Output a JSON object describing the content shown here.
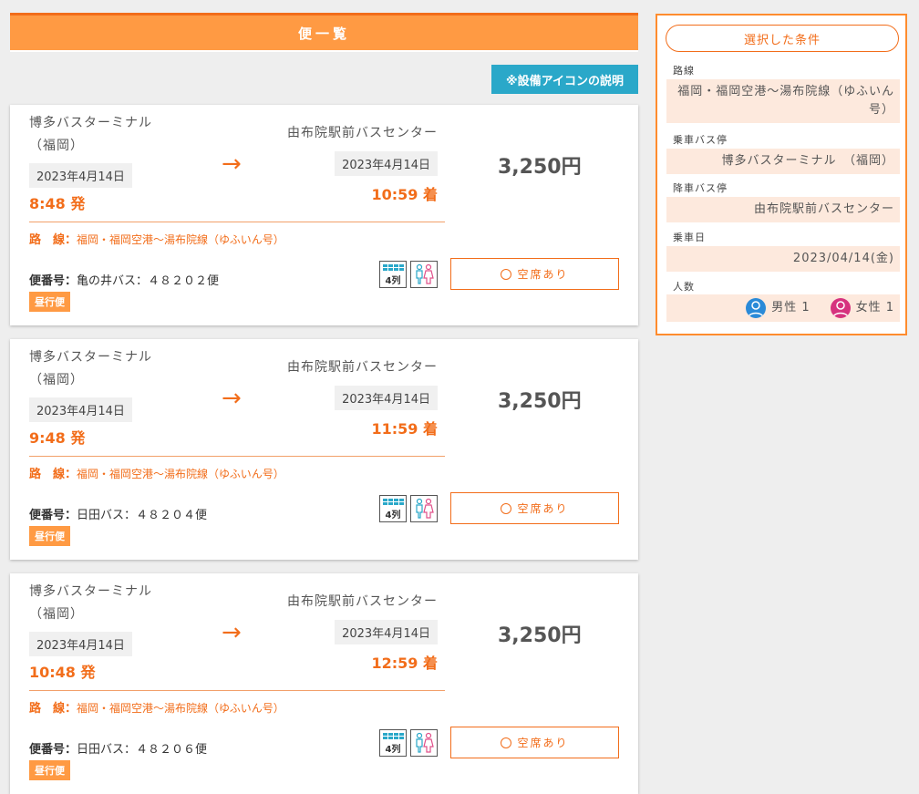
{
  "header": {
    "title": "便一覧"
  },
  "legend_button": "※設備アイコンの説明",
  "colors": {
    "accent": "#f26d1a",
    "header_bg": "#ff9a43",
    "info_button": "#2aa8c9"
  },
  "trips": [
    {
      "dep_name_line1": "博多バスターミナル",
      "dep_name_line2": "（福岡）",
      "dep_date": "2023年4月14日",
      "dep_time": "8:48 発",
      "arr_name": "由布院駅前バスセンター",
      "arr_date": "2023年4月14日",
      "arr_time": "10:59 着",
      "price": "3,250円",
      "route_label": "路　線：",
      "route_value": "福岡・福岡空港～湯布院線（ゆふいん号）",
      "flight_label": "便番号：",
      "flight_value": "亀の井バス：４８２０２便",
      "badge": "昼行便",
      "availability": "空席あり",
      "seat_icon_label": "4列"
    },
    {
      "dep_name_line1": "博多バスターミナル",
      "dep_name_line2": "（福岡）",
      "dep_date": "2023年4月14日",
      "dep_time": "9:48 発",
      "arr_name": "由布院駅前バスセンター",
      "arr_date": "2023年4月14日",
      "arr_time": "11:59 着",
      "price": "3,250円",
      "route_label": "路　線：",
      "route_value": "福岡・福岡空港～湯布院線（ゆふいん号）",
      "flight_label": "便番号：",
      "flight_value": "日田バス：４８２０４便",
      "badge": "昼行便",
      "availability": "空席あり",
      "seat_icon_label": "4列"
    },
    {
      "dep_name_line1": "博多バスターミナル",
      "dep_name_line2": "（福岡）",
      "dep_date": "2023年4月14日",
      "dep_time": "10:48 発",
      "arr_name": "由布院駅前バスセンター",
      "arr_date": "2023年4月14日",
      "arr_time": "12:59 着",
      "price": "3,250円",
      "route_label": "路　線：",
      "route_value": "福岡・福岡空港～湯布院線（ゆふいん号）",
      "flight_label": "便番号：",
      "flight_value": "日田バス：４８２０６便",
      "badge": "昼行便",
      "availability": "空席あり",
      "seat_icon_label": "4列"
    }
  ],
  "sidebar": {
    "title": "選択した条件",
    "route_label": "路線",
    "route_value": "福岡・福岡空港～湯布院線（ゆふいん号）",
    "board_label": "乗車バス停",
    "board_value": "博多バスターミナル　（福岡）",
    "alight_label": "降車バス停",
    "alight_value": "由布院駅前バスセンター",
    "date_label": "乗車日",
    "date_value": "2023/04/14(金)",
    "pax_label": "人数",
    "male_label": "男性 1",
    "female_label": "女性 1",
    "male_color": "#2a8ad8",
    "female_color": "#d6337e"
  }
}
